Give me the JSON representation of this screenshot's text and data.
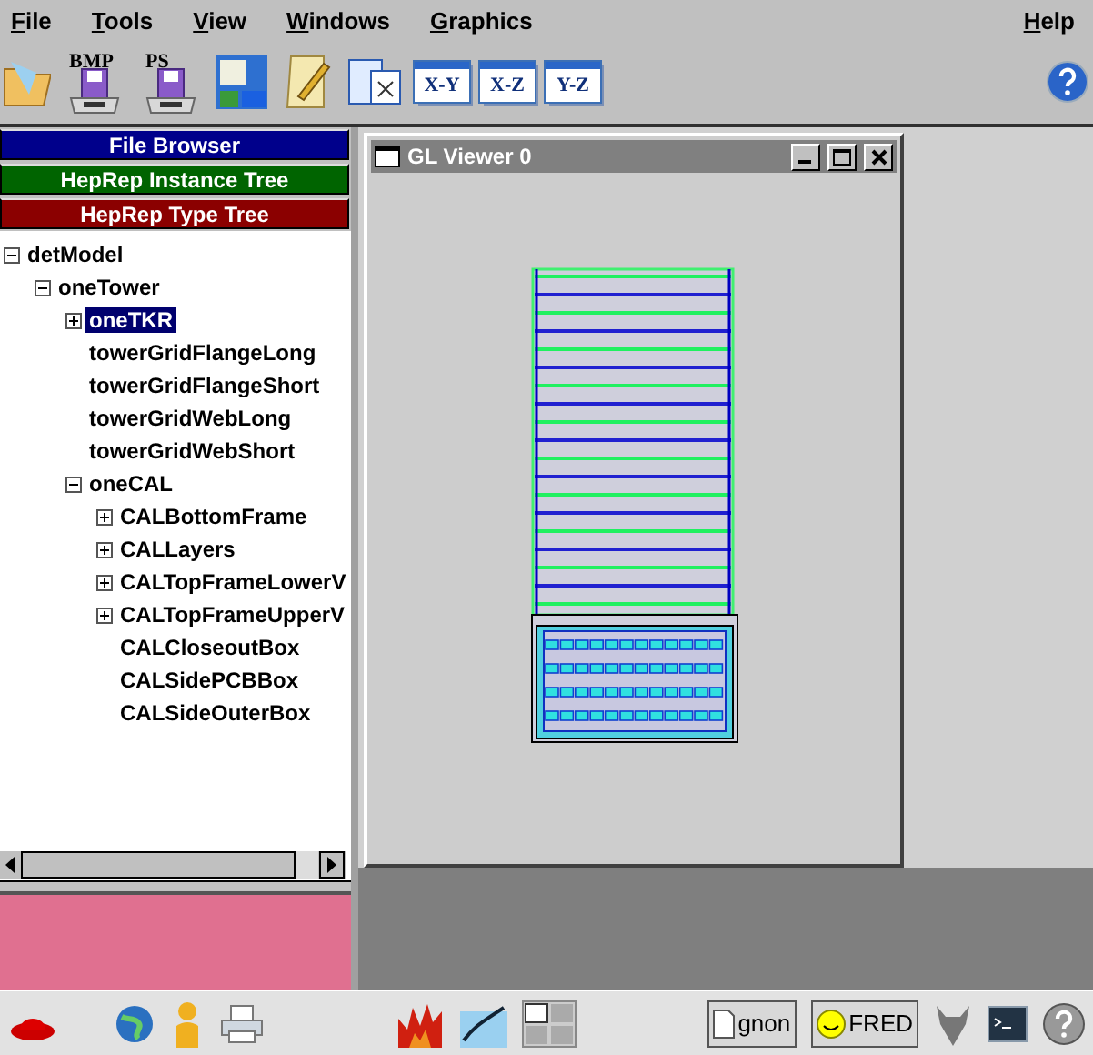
{
  "menu": {
    "items": [
      "File",
      "Tools",
      "View",
      "Windows",
      "Graphics"
    ],
    "help": "Help"
  },
  "toolbar": {
    "disk_labels": [
      "BMP",
      "PS"
    ],
    "view_buttons": [
      "X-Y",
      "X-Z",
      "Y-Z"
    ]
  },
  "panel_tabs": [
    {
      "label": "File Browser",
      "color": "#00008b"
    },
    {
      "label": "HepRep Instance Tree",
      "color": "#006400"
    },
    {
      "label": "HepRep Type Tree",
      "color": "#8b0000"
    }
  ],
  "tree": [
    {
      "label": "detModel",
      "kind": "branch",
      "expanded": true,
      "selected": false,
      "children": [
        {
          "label": "oneTower",
          "kind": "branch",
          "expanded": true,
          "selected": false,
          "children": [
            {
              "label": "oneTKR",
              "kind": "branch",
              "expanded": false,
              "selected": true
            },
            {
              "label": "towerGridFlangeLong",
              "kind": "leaf",
              "selected": false
            },
            {
              "label": "towerGridFlangeShort",
              "kind": "leaf",
              "selected": false
            },
            {
              "label": "towerGridWebLong",
              "kind": "leaf",
              "selected": false
            },
            {
              "label": "towerGridWebShort",
              "kind": "leaf",
              "selected": false
            },
            {
              "label": "oneCAL",
              "kind": "branch",
              "expanded": true,
              "selected": false,
              "children": [
                {
                  "label": "CALBottomFrame",
                  "kind": "branch",
                  "expanded": false,
                  "selected": false
                },
                {
                  "label": "CALLayers",
                  "kind": "branch",
                  "expanded": false,
                  "selected": false
                },
                {
                  "label": "CALTopFrameLowerV",
                  "kind": "branch",
                  "expanded": false,
                  "selected": false
                },
                {
                  "label": "CALTopFrameUpperV",
                  "kind": "branch",
                  "expanded": false,
                  "selected": false
                },
                {
                  "label": "CALCloseoutBox",
                  "kind": "leaf",
                  "selected": false
                },
                {
                  "label": "CALSidePCBBox",
                  "kind": "leaf",
                  "selected": false
                },
                {
                  "label": "CALSideOuterBox",
                  "kind": "leaf",
                  "selected": false
                }
              ]
            }
          ]
        }
      ]
    }
  ],
  "viewer": {
    "title": "GL Viewer 0"
  },
  "taskbar": {
    "tasks": [
      "gnon",
      "FRED"
    ]
  }
}
